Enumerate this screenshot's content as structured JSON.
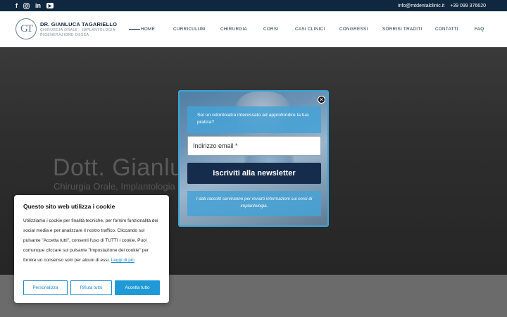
{
  "topbar": {
    "social_icons": [
      "facebook-icon",
      "instagram-icon",
      "linkedin-icon",
      "youtube-icon"
    ],
    "email": "info@mtdentalclinic.it",
    "phone": "+39 099 376620"
  },
  "logo": {
    "monogram": "GT",
    "name": "DR. GIANLUCA TAGARIELLO",
    "subtitle_line1": "CHIRURGIA ORALE - IMPLANTOLOGIA",
    "subtitle_line2": "RIGENERAZIONE OSSEA"
  },
  "nav": {
    "items": [
      {
        "label": "HOME"
      },
      {
        "label": "CURRICULUM"
      },
      {
        "label": "CHIRURGIA"
      },
      {
        "label": "CORSI"
      },
      {
        "label": "CASI CLINICI"
      },
      {
        "label": "CONGRESSI"
      },
      {
        "label": "SORRISI TRADITI"
      },
      {
        "label": "CONTATTI"
      },
      {
        "label": "FAQ"
      }
    ]
  },
  "hero": {
    "title": "Dott. Gianluca Tagariello",
    "subtitle": "Chirurgia Orale, Implantologia e Rigenerazione Ossea"
  },
  "newsletter": {
    "close_label": "×",
    "intro": "Sei un odontoiatra interessato ad approfondire la tua pratica?",
    "email_placeholder": "Indirizzo email *",
    "subscribe_label": "Iscriviti alla newsletter",
    "privacy": "I dati raccolti serviranno per inviarti informazioni sui corsi di implantologia."
  },
  "cookie": {
    "title": "Questo sito web utilizza i cookie",
    "text": "Utilizziamo i cookie per finalità tecniche, per fornire funzionalità dei social media e per analizzare il nostro traffico. Cliccando sul pulsante \"Accetta tutti\", consenti l'uso di TUTTI i cookie. Puoi comunque cliccare sul pulsante \"Impostazione dei cookie\" per fornire un consenso solo per alcuni di essi.",
    "link_label": "Leggi di più",
    "customize_label": "Personalizza",
    "reject_label": "Rifiuta tutto",
    "accept_label": "Accetta tutto"
  },
  "colors": {
    "navy": "#0f2840",
    "popup_border": "#3aa6d8",
    "button_navy": "#152c4c",
    "accent_blue": "#1f9ad7"
  }
}
